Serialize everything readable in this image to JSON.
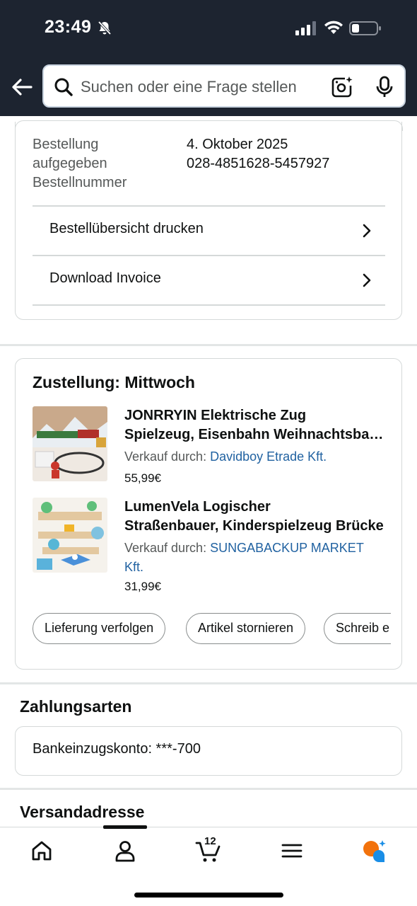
{
  "status_bar": {
    "time": "23:49"
  },
  "search": {
    "placeholder": "Suchen oder eine Frage stellen"
  },
  "order": {
    "placed_label": "Bestellung aufgegeben",
    "placed_label_line1": "Bestellung",
    "placed_label_line2": "aufgegeben",
    "placed_date": "4. Oktober 2025",
    "number_label": "Bestellnummer",
    "number": "028-4851628-5457927",
    "actions": [
      {
        "label": "Bestellübersicht drucken"
      },
      {
        "label": "Download Invoice"
      }
    ]
  },
  "delivery": {
    "title": "Zustellung: Mittwoch",
    "items": [
      {
        "title_line1": "JONRRYIN Elektrische Zug",
        "title_line2": "Spielzeug, Eisenbahn Weihnachtsbaum",
        "seller_prefix": "Verkauf durch:",
        "seller": "Davidboy Etrade Kft.",
        "price": "55,99€"
      },
      {
        "title_line1": "LumenVela Logischer",
        "title_line2": "Straßenbauer, Kinderspielzeug Brücke",
        "seller_prefix": "Verkauf durch:",
        "seller_line1": "SUNGABACKUP MARKET",
        "seller_line2": "Kft.",
        "price": "31,99€"
      }
    ],
    "buttons": [
      {
        "label": "Lieferung verfolgen"
      },
      {
        "label": "Artikel stornieren"
      },
      {
        "label": "Schreib e"
      }
    ]
  },
  "payment": {
    "title": "Zahlungsarten",
    "method": "Bankeinzugskonto: ***-700"
  },
  "shipping": {
    "title": "Versandadresse"
  },
  "nav": {
    "cart_count": "12"
  }
}
